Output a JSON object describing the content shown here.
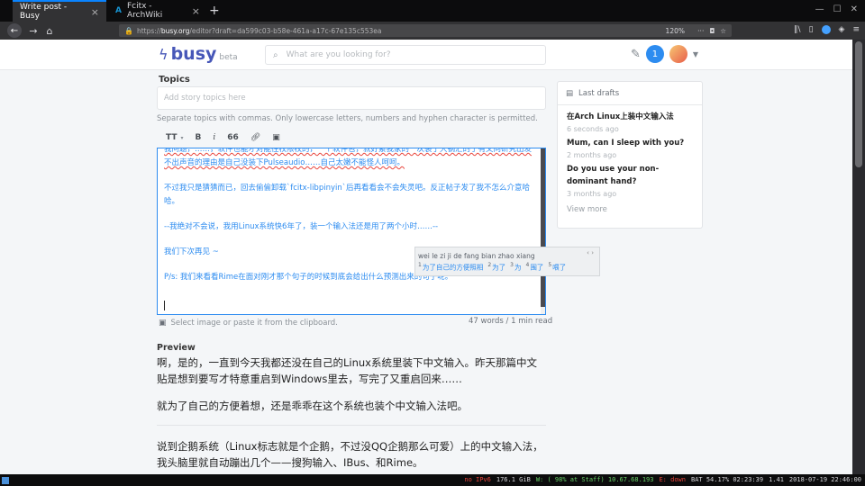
{
  "browser": {
    "tabs": [
      {
        "title": "Write post - Busy",
        "active": true
      },
      {
        "title": "Fcitx - ArchWiki",
        "active": false
      }
    ],
    "url_host": "busy.org",
    "url_path": "/editor?draft=da599c03-b58e-461a-a17c-67e135c553ea",
    "url_prefix": "https://",
    "zoom": "120%"
  },
  "header": {
    "logo": "busy",
    "beta": "beta",
    "search_placeholder": "What are you looking for?",
    "notification_count": "1"
  },
  "form": {
    "topics_label": "Topics",
    "topics_placeholder": "Add story topics here",
    "topics_hint": "Separate topics with commas. Only lowercase letters, numbers and hyphen character is permitted.",
    "toolbar": {
      "heading": "TT",
      "bold": "B",
      "italic": "i",
      "quote": "66"
    },
    "editor_lines": [
      "我问题，……，软件也能才对能往权限权的，一个软件包，就好累我家的一次装了大锅汇的了有又向研究出发不出声音的理由是自己没装下Pulseaudio……自己太嫩不能怪人呵呵。",
      "不过我只是猜猜而已，回去偷偷卸载`fcitx-libpinyin`后再看看会不会失灵吧。反正帖子发了我不怎么介意哈哈。",
      "--我绝对不会说，我用Linux系统快6年了，装一个输入法还是用了两个小时……--",
      "我们下次再见 ~",
      "P/s: 我们来看看Rime在面对刚才那个句子的时候到底会给出什么预测出来的句子呢。"
    ],
    "image_hint": "Select image or paste it from the clipboard.",
    "word_count": "47 words / 1 min read",
    "preview_label": "Preview",
    "preview_paragraphs": [
      "啊，是的，一直到今天我都还没在自己的Linux系统里装下中文输入。昨天那篇中文贴是想到要写才特意重启到Windows里去，写完了又重启回来……",
      "就为了自己的方便着想，还是乖乖在这个系统也装个中文输入法吧。",
      "说到企鹅系统（Linux标志就是个企鹅，不过没QQ企鹅那么可爱）上的中文输入法，我头脑里就自动蹦出几个——搜狗输入、IBus、和Rime。"
    ]
  },
  "ime": {
    "pinyin": "wei le zi ji de fang bian zhao xiang",
    "arrows": "‹ ›",
    "candidates": [
      {
        "n": "1",
        "text": "为了自己的方便照相"
      },
      {
        "n": "2",
        "text": "为了"
      },
      {
        "n": "3",
        "text": "为"
      },
      {
        "n": "4",
        "text": "围了"
      },
      {
        "n": "5",
        "text": "喂了"
      }
    ]
  },
  "drafts": {
    "title": "Last drafts",
    "items": [
      {
        "title": "在Arch Linux上装中文输入法",
        "time": "6 seconds ago"
      },
      {
        "title": "Mum, can I sleep with you?",
        "time": "2 months ago"
      },
      {
        "title": "Do you use your non-dominant hand?",
        "time": "3 months ago"
      }
    ],
    "view_more": "View more"
  },
  "statusbar": {
    "items": [
      {
        "text": "no IPv6",
        "color": "#e8453c"
      },
      {
        "text": "176.1 GiB",
        "color": "#d7d7db"
      },
      {
        "text": "W: ( 98% at Staff) 10.67.68.193",
        "color": "#6ad36a"
      },
      {
        "text": "E: down",
        "color": "#e8453c"
      },
      {
        "text": "BAT 54.17% 02:23:39",
        "color": "#d7d7db"
      },
      {
        "text": "1.41",
        "color": "#d7d7db"
      },
      {
        "text": "2018-07-19 22:46:00",
        "color": "#d7d7db"
      }
    ]
  },
  "colors": {
    "accent": "#2d8cf0",
    "brand": "#4757b8",
    "firefox_blue": "#0a84ff"
  }
}
